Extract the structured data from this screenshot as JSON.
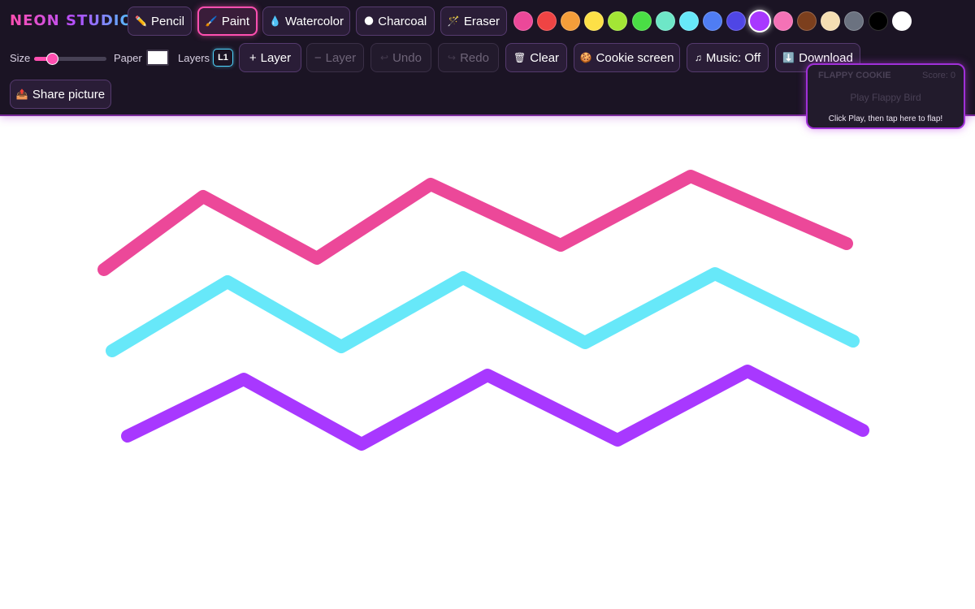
{
  "app": {
    "brand": "NEON STUDIO"
  },
  "tools": [
    {
      "id": "pencil",
      "label": "Pencil",
      "icon": "✏️",
      "active": false
    },
    {
      "id": "paint",
      "label": "Paint",
      "icon": "🖌️",
      "active": true
    },
    {
      "id": "watercolor",
      "label": "Watercolor",
      "icon": "💧",
      "active": false
    },
    {
      "id": "charcoal",
      "label": "Charcoal",
      "icon": "🌑",
      "active": false
    },
    {
      "id": "eraser",
      "label": "Eraser",
      "icon": "🪄",
      "active": false
    }
  ],
  "palette": {
    "selected": "#a838ff",
    "colors": [
      "#ec4899",
      "#ef4444",
      "#f59e3a",
      "#fde047",
      "#a3e635",
      "#4ade45",
      "#6ee7c7",
      "#67e8f9",
      "#4f7df3",
      "#4f46e5",
      "#a838ff",
      "#f472b6",
      "#7c3f1d",
      "#f5deb3",
      "#6b7280",
      "#000000",
      "#ffffff"
    ]
  },
  "controls": {
    "size_label": "Size",
    "size_fraction": 0.25,
    "paper_label": "Paper",
    "paper_color": "#ffffff",
    "layers_label": "Layers",
    "current_layer": "L1"
  },
  "actions": {
    "add_layer": {
      "label": "Layer",
      "icon": "+"
    },
    "remove_layer": {
      "label": "Layer",
      "icon": "−"
    },
    "undo": {
      "label": "Undo",
      "icon": "↩"
    },
    "redo": {
      "label": "Redo",
      "icon": "↪"
    },
    "clear": {
      "label": "Clear",
      "icon": "🗑"
    },
    "cookie_screen": {
      "label": "Cookie screen",
      "icon": "🍪"
    },
    "music": {
      "label": "Music: Off",
      "icon": "♫"
    },
    "download": {
      "label": "Download",
      "icon": "⬇️"
    },
    "share": {
      "label": "Share picture",
      "icon": "📤"
    }
  },
  "game": {
    "title": "FLAPPY COOKIE",
    "score": "Score: 0",
    "play": "Play Flappy Bird",
    "hint": "Click Play, then tap here to flap!"
  },
  "canvas": {
    "strokes": [
      {
        "color": "#ec4899",
        "width": 16
      },
      {
        "color": "#67e8f9",
        "width": 16
      },
      {
        "color": "#a838ff",
        "width": 16
      }
    ]
  }
}
